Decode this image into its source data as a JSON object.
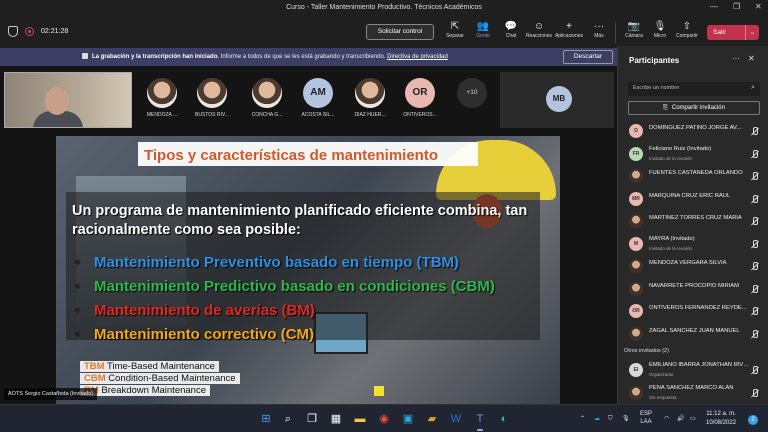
{
  "window": {
    "title": "Curso - Taller Mantenimiento Productivo. Técnicos Académicos"
  },
  "toolbar": {
    "elapsed": "02:21:28",
    "request_control": "Solicitar control",
    "items": [
      {
        "label": "Separar",
        "glyph": "⇱"
      },
      {
        "label": "Gente",
        "glyph": "👥",
        "active": true
      },
      {
        "label": "Chat",
        "glyph": "💬"
      },
      {
        "label": "Reacciones",
        "glyph": "☺"
      },
      {
        "label": "Aplicaciones",
        "glyph": "+"
      },
      {
        "label": "Más",
        "glyph": "···"
      },
      {
        "label": "Cámara",
        "glyph": "📷"
      },
      {
        "label": "Micro",
        "glyph": "🎙"
      },
      {
        "label": "Compartir",
        "glyph": "⇧"
      }
    ],
    "leave": "Salir",
    "leave_color": "#c4314b"
  },
  "banner": {
    "bold": "La grabación y la transcripción han iniciado.",
    "text": "Informe a todos de que se les está grabando y transcribiendo.",
    "link": "Directiva de privacidad",
    "dismiss": "Descartar",
    "color": "#3d3e66"
  },
  "gallery": {
    "participants": [
      {
        "name": "MENDOZA ...",
        "initials": ""
      },
      {
        "name": "BUSTOS RIV...",
        "initials": ""
      },
      {
        "name": "CONCHA G...",
        "initials": ""
      },
      {
        "name": "ACOSTA SIL...",
        "initials": "AM"
      },
      {
        "name": "DIAZ HUER...",
        "initials": ""
      },
      {
        "name": "ONTIVEROS...",
        "initials": "OR"
      }
    ],
    "more": "+10",
    "tile_initials": "MB"
  },
  "slide": {
    "title": "Tipos y características de mantenimiento",
    "intro": "Un programa de mantenimiento planificado eficiente combina, tan racionalmente como sea posible:",
    "bullets": [
      {
        "text": "Mantenimiento Preventivo basado en tiempo (TBM)",
        "color": "#2f8fe0"
      },
      {
        "text": "Mantenimiento Predictivo basado en condiciones (CBM)",
        "color": "#2fb84a"
      },
      {
        "text": "Mantenimiento de averías (BM)",
        "color": "#e0281e"
      },
      {
        "text": "Mantenimiento correctivo (CM)",
        "color": "#f2a81c"
      }
    ],
    "legend": [
      {
        "abbr": "TBM",
        "text": "Time-Based Maintenance",
        "color": "#e07a2a"
      },
      {
        "abbr": "CBM",
        "text": "Condition-Based Maintenance",
        "color": "#e07a2a"
      },
      {
        "abbr": "BM",
        "text": "Breakdown Maintenance",
        "color": "#e07a2a"
      }
    ],
    "title_color": "#d05a2a"
  },
  "presenter_name": "AOTS Sergio Castañeda (Invitado)",
  "panel": {
    "title": "Participantes",
    "search_placeholder": "Escribe un nombre",
    "invite": "Compartir invitación",
    "rows": [
      {
        "name": "DOMINGUEZ PATINO JORGE AV...",
        "sub": "",
        "initials": "D",
        "color": "#e8b7b0"
      },
      {
        "name": "Feliciano Ruiz (Invitado)",
        "sub": "Invitado de la reunión",
        "initials": "FR",
        "color": "#b9d8b4"
      },
      {
        "name": "FUENTES CASTAÑEDA ORLANDO",
        "sub": "",
        "initials": "",
        "color": ""
      },
      {
        "name": "MARQUINA CRUZ ERIC RAUL",
        "sub": "",
        "initials": "MR",
        "color": "#e8b7b0"
      },
      {
        "name": "MARTINEZ TORRES CRUZ MARIA",
        "sub": "",
        "initials": "",
        "color": ""
      },
      {
        "name": "MAYRA (Invitado)",
        "sub": "Invitado de la reunión",
        "initials": "M",
        "color": "#e8b7b0"
      },
      {
        "name": "MENDOZA VERGARA SILVIA",
        "sub": "",
        "initials": "",
        "color": ""
      },
      {
        "name": "NAVARRETE PROCOPIO MIRIAM",
        "sub": "",
        "initials": "",
        "color": ""
      },
      {
        "name": "ONTIVEROS FERNANDEZ REYDE...",
        "sub": "",
        "initials": "OR",
        "color": "#e8b7b0"
      },
      {
        "name": "ZAGAL SANCHEZ JUAN MANUEL",
        "sub": "",
        "initials": "",
        "color": ""
      }
    ],
    "others_section": "Otros invitados (2)",
    "others": [
      {
        "name": "EMILIANO IBARRA JONATHAN IRVI...",
        "sub": "Organizador",
        "initials": "EI",
        "color": "#d8d8d8"
      },
      {
        "name": "PEÑA SANCHEZ MARCO ALAN",
        "sub": "Sin respuesta",
        "initials": "",
        "color": ""
      }
    ]
  },
  "taskbar": {
    "lang": "ESP",
    "lang2": "LAA",
    "time": "11:12 a. m.",
    "date": "10/08/2022",
    "badge": "2"
  }
}
